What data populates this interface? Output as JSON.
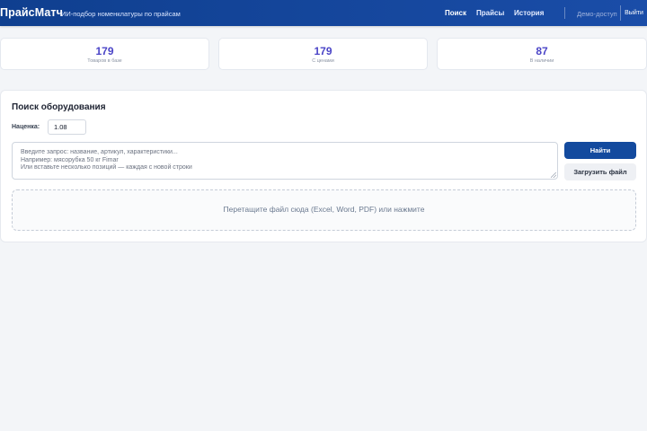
{
  "header": {
    "brand": "ПрайсМатч",
    "tagline": "ИИ-подбор номенклатуры по прайсам",
    "nav": [
      "Поиск",
      "Прайсы",
      "История"
    ],
    "active_nav": "Поиск",
    "demo_label": "Демо-доступ",
    "logout_label": "Выйти"
  },
  "stats": [
    {
      "value": "179",
      "label": "Товаров в базе"
    },
    {
      "value": "179",
      "label": "С ценами"
    },
    {
      "value": "87",
      "label": "В наличии"
    }
  ],
  "search": {
    "title": "Поиск оборудования",
    "markup_label": "Наценка:",
    "markup_value": "1.08",
    "placeholder_lines": [
      "Введите запрос: название, артикул, характеристики...",
      "Например: мясорубка 50 кг Fimar",
      "Или вставьте несколько позиций — каждая с новой строки"
    ],
    "find_button": "Найти",
    "upload_button": "Загрузить файл",
    "dropzone_text": "Перетащите файл сюда (Excel, Word, PDF) или нажмите"
  },
  "colors": {
    "header_bg": "#134a9e",
    "accent": "#4b45c7",
    "primary_button": "#134a9e"
  }
}
